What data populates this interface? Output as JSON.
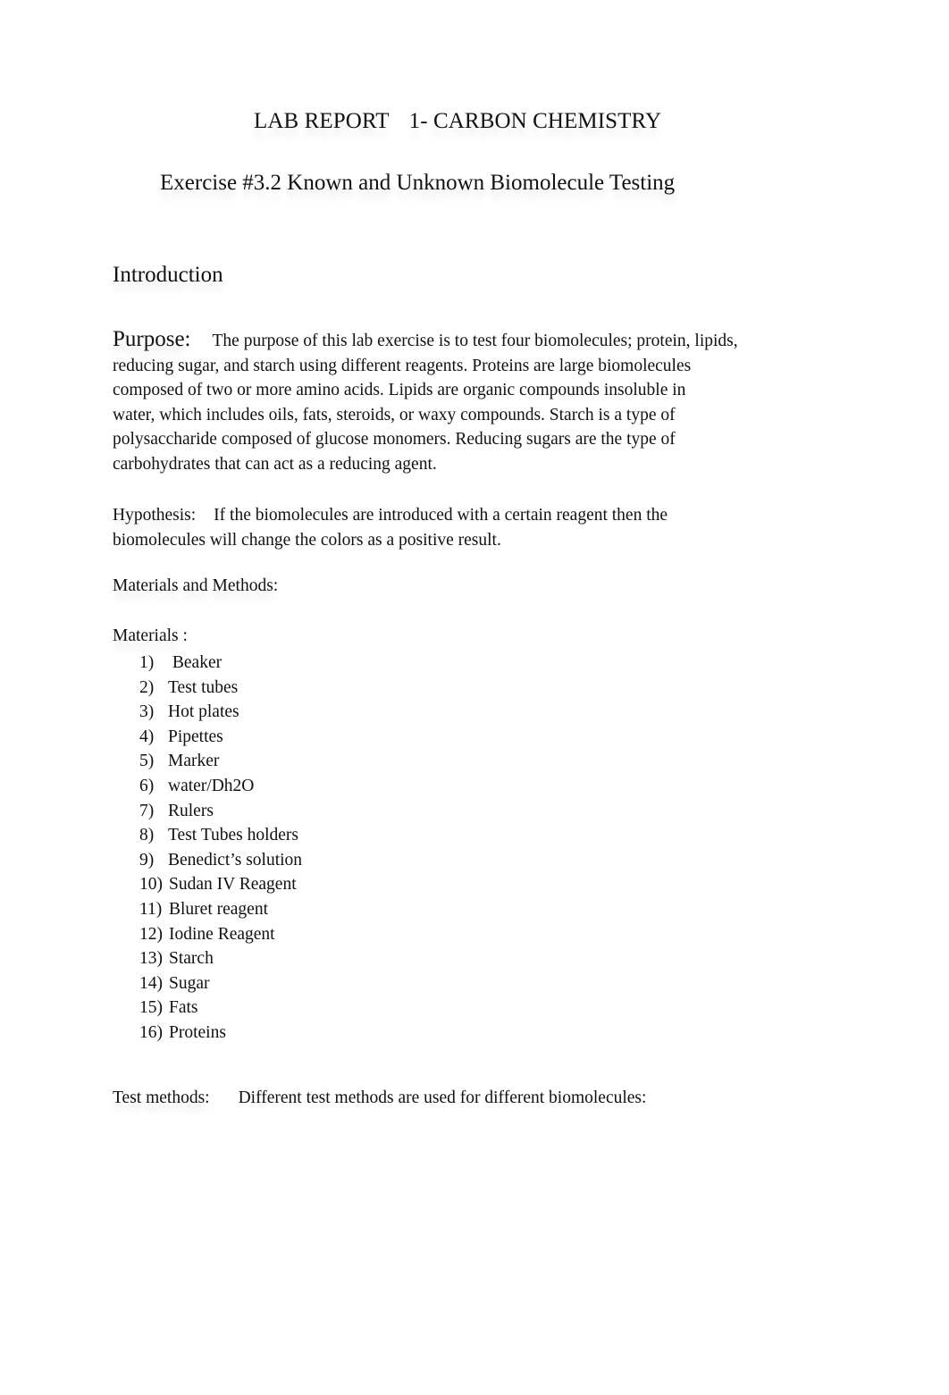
{
  "document": {
    "title_part1": "LAB REPORT",
    "title_part2": "1- CARBON CHEMISTRY",
    "subtitle": "Exercise #3.2 Known and Unknown Biomolecule Testing",
    "introduction_heading": "Introduction",
    "purpose": {
      "label": "Purpose:",
      "lines": [
        "The purpose of this lab exercise is to test four biomolecules; protein, lipids,",
        "reducing sugar, and starch using different reagents. Proteins are large biomolecules",
        "composed of two or more amino acids. Lipids are organic compounds insoluble in",
        "water, which includes oils, fats, steroids, or waxy compounds. Starch is a type of",
        "polysaccharide composed of glucose monomers. Reducing sugars are the type of",
        "carbohydrates that can act as a reducing agent."
      ]
    },
    "hypothesis": {
      "label": "Hypothesis:",
      "lines": [
        "If the biomolecules are introduced with a certain reagent then the",
        "biomolecules will change the colors as a positive result."
      ]
    },
    "materials_and_methods_heading": "Materials and Methods:",
    "materials": {
      "label": "Materials  :",
      "items": [
        {
          "num": "1)",
          "text": " Beaker"
        },
        {
          "num": "2)",
          "text": "Test tubes"
        },
        {
          "num": "3)",
          "text": "Hot plates"
        },
        {
          "num": "4)",
          "text": "Pipettes"
        },
        {
          "num": "5)",
          "text": "Marker"
        },
        {
          "num": "6)",
          "text": "water/Dh2O"
        },
        {
          "num": "7)",
          "text": "Rulers"
        },
        {
          "num": "8)",
          "text": "Test Tubes holders"
        },
        {
          "num": "9)",
          "text": "Benedict’s solution"
        },
        {
          "num": "10)",
          "text": "Sudan IV Reagent"
        },
        {
          "num": "11)",
          "text": "Bluret reagent"
        },
        {
          "num": "12)",
          "text": "Iodine Reagent"
        },
        {
          "num": "13)",
          "text": "Starch"
        },
        {
          "num": "14)",
          "text": "Sugar"
        },
        {
          "num": "15)",
          "text": "Fats"
        },
        {
          "num": "16)",
          "text": "Proteins"
        }
      ]
    },
    "test_methods": {
      "label": "Test methods:",
      "text": "Different test methods are used for different biomolecules:"
    }
  }
}
